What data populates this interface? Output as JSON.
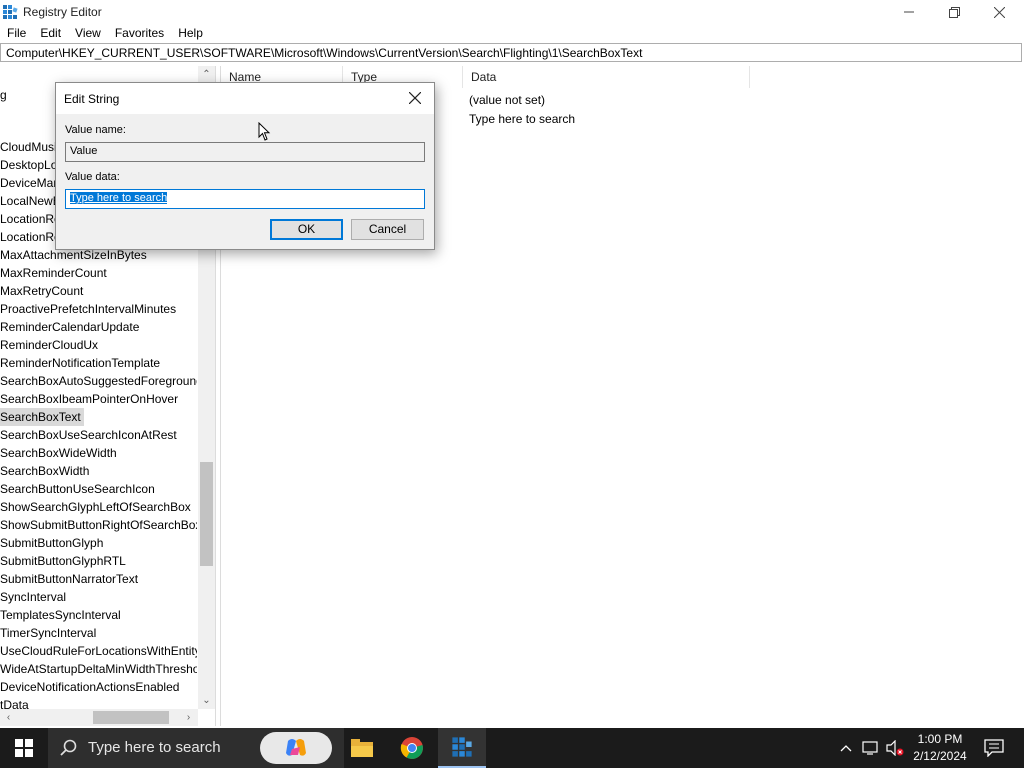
{
  "window": {
    "title": "Registry Editor"
  },
  "menu": [
    "File",
    "Edit",
    "View",
    "Favorites",
    "Help"
  ],
  "address": "Computer\\HKEY_CURRENT_USER\\SOFTWARE\\Microsoft\\Windows\\CurrentVersion\\Search\\Flighting\\1\\SearchBoxText",
  "tree": {
    "items": [
      {
        "label": "g",
        "selected": false
      },
      {
        "label": "CloudMusi",
        "selected": false
      },
      {
        "label": "DesktopLoc",
        "selected": false
      },
      {
        "label": "DeviceMan",
        "selected": false
      },
      {
        "label": "LocalNewB",
        "selected": false
      },
      {
        "label": "LocationRe",
        "selected": false
      },
      {
        "label": "LocationRe",
        "selected": false
      },
      {
        "label": "MaxAttachmentSizeInBytes",
        "selected": false
      },
      {
        "label": "MaxReminderCount",
        "selected": false
      },
      {
        "label": "MaxRetryCount",
        "selected": false
      },
      {
        "label": "ProactivePrefetchIntervalMinutes",
        "selected": false
      },
      {
        "label": "ReminderCalendarUpdate",
        "selected": false
      },
      {
        "label": "ReminderCloudUx",
        "selected": false
      },
      {
        "label": "ReminderNotificationTemplate",
        "selected": false
      },
      {
        "label": "SearchBoxAutoSuggestedForegroundC",
        "selected": false
      },
      {
        "label": "SearchBoxIbeamPointerOnHover",
        "selected": false
      },
      {
        "label": "SearchBoxText",
        "selected": true
      },
      {
        "label": "SearchBoxUseSearchIconAtRest",
        "selected": false
      },
      {
        "label": "SearchBoxWideWidth",
        "selected": false
      },
      {
        "label": "SearchBoxWidth",
        "selected": false
      },
      {
        "label": "SearchButtonUseSearchIcon",
        "selected": false
      },
      {
        "label": "ShowSearchGlyphLeftOfSearchBox",
        "selected": false
      },
      {
        "label": "ShowSubmitButtonRightOfSearchBox",
        "selected": false
      },
      {
        "label": "SubmitButtonGlyph",
        "selected": false
      },
      {
        "label": "SubmitButtonGlyphRTL",
        "selected": false
      },
      {
        "label": "SubmitButtonNarratorText",
        "selected": false
      },
      {
        "label": "SyncInterval",
        "selected": false
      },
      {
        "label": "TemplatesSyncInterval",
        "selected": false
      },
      {
        "label": "TimerSyncInterval",
        "selected": false
      },
      {
        "label": "UseCloudRuleForLocationsWithEntityI",
        "selected": false
      },
      {
        "label": "WideAtStartupDeltaMinWidthThreshol",
        "selected": false
      },
      {
        "label": "DeviceNotificationActionsEnabled",
        "selected": false
      },
      {
        "label": "tData",
        "selected": false
      }
    ]
  },
  "list": {
    "columns": [
      "Name",
      "Type",
      "Data"
    ],
    "rows": [
      {
        "data": "(value not set)"
      },
      {
        "data": "Type here to search"
      }
    ]
  },
  "dialog": {
    "title": "Edit String",
    "value_name_label": "Value name:",
    "value_name": "Value",
    "value_data_label": "Value data:",
    "value_data": "Type here to search",
    "ok": "OK",
    "cancel": "Cancel"
  },
  "taskbar": {
    "search_placeholder": "Type here to search",
    "time": "1:00 PM",
    "date": "2/12/2024"
  },
  "colors": {
    "accent": "#0078d7",
    "taskbar": "#1b1b1b"
  }
}
